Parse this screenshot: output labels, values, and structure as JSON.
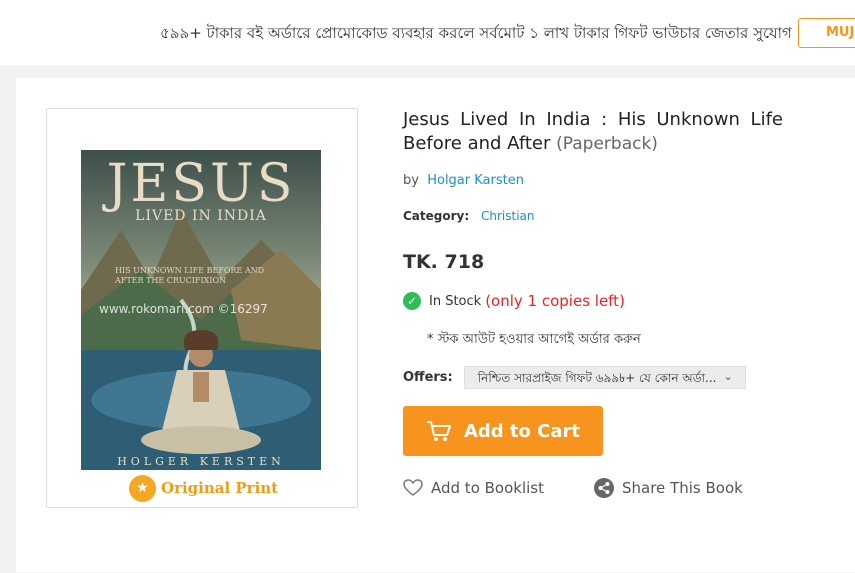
{
  "promo": {
    "text": "৫৯৯+ টাকার বই অর্ডারে প্রোমোকোড ব্যবহার করলে সর্বমোট ১ লাখ টাকার গিফট ভাউচার জেতার সুযোগ",
    "button_label": "MUJ"
  },
  "cover": {
    "title": "JESUS",
    "subtitle": "LIVED IN INDIA",
    "tagline": "HIS UNKNOWN LIFE BEFORE AND AFTER THE CRUCIFIXION",
    "watermark": "www.rokomari.com  ©16297",
    "author": "HOLGER KERSTEN",
    "badge_label": "Original Print"
  },
  "product": {
    "title": "Jesus Lived In India : His Unknown Life Before and After",
    "binding": "(Paperback)",
    "by_label": "by",
    "author": "Holgar Karsten",
    "category_label": "Category:",
    "category": "Christian",
    "price": "TK. 718",
    "stock_label": "In Stock",
    "stock_left": "(only 1 copies left)",
    "stock_warning": "* স্টক আউট হওয়ার আগেই অর্ডার করুন",
    "offers_label": "Offers:",
    "offer_selected": "নিশ্চিত সারপ্রাইজ গিফট ৬৯৯৳+ যে কোন অর্ডা...",
    "add_to_cart": "Add to Cart",
    "add_to_booklist": "Add to Booklist",
    "share": "Share This Book"
  },
  "colors": {
    "accent": "#f7941d",
    "link": "#1a8fcf",
    "stock": "#2ebd59",
    "warning": "#e22222"
  }
}
